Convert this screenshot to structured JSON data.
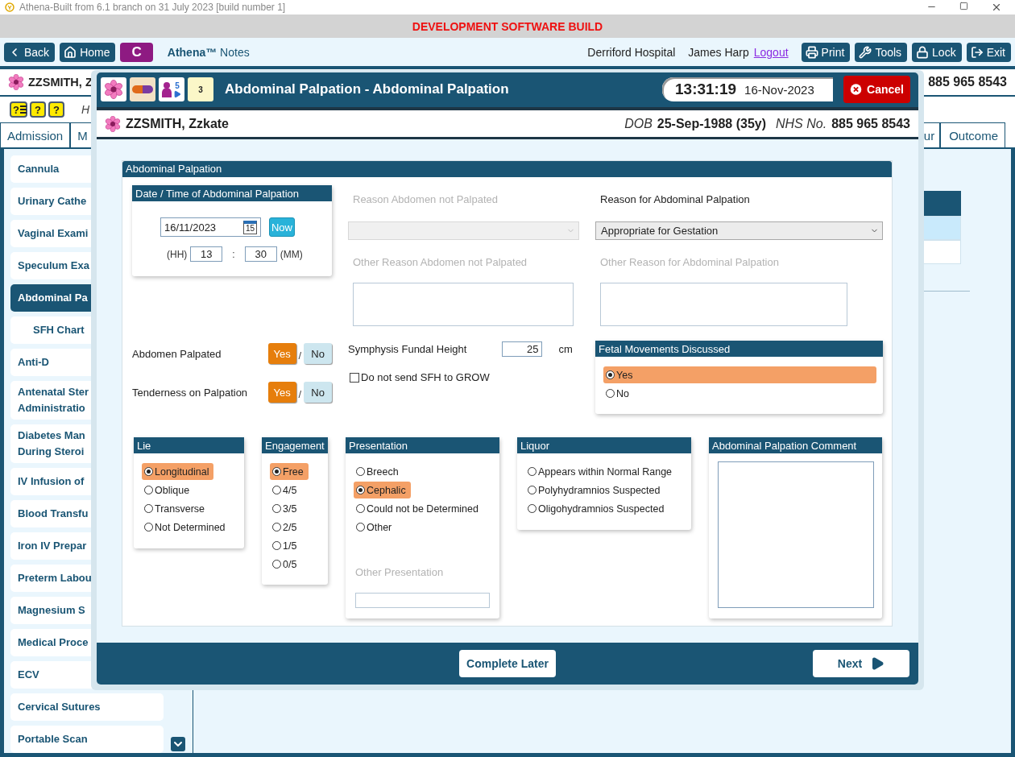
{
  "titlebar": {
    "title": "Athena-Built from 6.1 branch on 31 July 2023 [build number 1]"
  },
  "banner": "DEVELOPMENT SOFTWARE BUILD",
  "toolbar": {
    "left_buttons": [
      {
        "kind": "back",
        "label": "Back"
      },
      {
        "kind": "home",
        "label": "Home"
      },
      {
        "kind": "letter",
        "label": "C"
      }
    ],
    "app_name": "**Athena™** Notes",
    "hospital": "Derriford Hospital",
    "user": "James Harp",
    "logout": "Logout",
    "right_buttons": [
      {
        "kind": "print",
        "label": "Print"
      },
      {
        "kind": "tools",
        "label": "Tools"
      },
      {
        "kind": "lock",
        "label": "Lock"
      },
      {
        "kind": "exit",
        "label": "Exit"
      }
    ]
  },
  "patient_bar": {
    "name": "ZZSMITH, Z",
    "nhs_number": "885 965 8543"
  },
  "alert_icons": [
    {
      "kind": "list",
      "symbol": "?"
    },
    {
      "kind": "help",
      "symbol": "?"
    },
    {
      "kind": "help",
      "symbol": "?"
    }
  ],
  "alert_text": "H",
  "tabs_left": [
    {
      "label": "Admission",
      "selected": false
    },
    {
      "label": "M",
      "selected": false
    }
  ],
  "tabs_right": [
    {
      "label": "ur",
      "selected": false
    },
    {
      "label": "Outcome",
      "selected": false
    }
  ],
  "sidebar": {
    "items": [
      {
        "label": "Cannula",
        "selected": false
      },
      {
        "label": "Urinary Cathe",
        "selected": false
      },
      {
        "label": "Vaginal Exami",
        "selected": false
      },
      {
        "label": "Speculum Exa",
        "selected": false
      },
      {
        "label": "Abdominal Pa",
        "selected": true,
        "children": [
          {
            "label": "SFH Chart",
            "selected": false
          }
        ]
      },
      {
        "label": "Anti-D",
        "selected": false
      },
      {
        "label": "Antenatal Ster\nAdministratio",
        "selected": false
      },
      {
        "label": "Diabetes Man\nDuring Steroi",
        "selected": false
      },
      {
        "label": "IV Infusion of",
        "selected": false
      },
      {
        "label": "Blood Transfu",
        "selected": false
      },
      {
        "label": "Iron IV Prepar",
        "selected": false
      },
      {
        "label": "Preterm Labou",
        "selected": false
      },
      {
        "label": "Magnesium S",
        "selected": false
      },
      {
        "label": "Medical Proce",
        "selected": false
      },
      {
        "label": "ECV",
        "selected": false
      },
      {
        "label": "Cervical Sutures",
        "selected": false
      },
      {
        "label": "Portable Scan",
        "selected": false
      }
    ]
  },
  "dialog": {
    "title": "Abdominal Palpation - Abdominal Palpation",
    "task_count": "5",
    "notes_count": "3",
    "time": "13:31:19",
    "date": "16-Nov-2023",
    "cancel": "Cancel",
    "patient": {
      "name": "ZZSMITH, Zzkate",
      "dob_label": "DOB",
      "dob": "25-Sep-1988 (35y)",
      "nhs_label": "NHS No.",
      "nhs_number": "885 965 8543"
    },
    "section_title": "Abdominal Palpation",
    "datetime": {
      "title": "Date / Time of Abdominal Palpation",
      "date": "16/11/2023",
      "calendar_day": "15",
      "now": "Now",
      "hh_label": "(HH)",
      "hours": "13",
      "separator": ":",
      "minutes": "30",
      "mm_label": "(MM)"
    },
    "reason_fields": [
      {
        "kind": "select",
        "label": "Reason Abdomen not Palpated",
        "disabled": true
      },
      {
        "kind": "select",
        "label": "Reason for Abdominal Palpation",
        "value": "Appropriate for Gestation",
        "disabled": false
      },
      {
        "kind": "textarea",
        "label": "Other Reason Abdomen not Palpated",
        "disabled": true
      },
      {
        "kind": "textarea",
        "label": "Other Reason for Abdominal Palpation",
        "disabled": true
      }
    ],
    "yes_no": [
      {
        "label": "Abdomen Palpated",
        "separator": "/",
        "options": [
          {
            "label": "Yes",
            "selected": true
          },
          {
            "label": "No",
            "selected": false
          }
        ]
      },
      {
        "label": "Tenderness on Palpation",
        "separator": "/",
        "options": [
          {
            "label": "Yes",
            "selected": true
          },
          {
            "label": "No",
            "selected": false
          }
        ]
      }
    ],
    "sfh": {
      "label": "Symphysis Fundal Height",
      "value": "25",
      "unit": "cm"
    },
    "grow_checkbox": {
      "label": "Do not send SFH to GROW",
      "checked": false
    },
    "fetal_movements": {
      "title": "Fetal Movements Discussed",
      "options": [
        {
          "label": "Yes",
          "selected": true
        },
        {
          "label": "No",
          "selected": false
        }
      ]
    },
    "groups": [
      {
        "title": "Lie",
        "options": [
          {
            "label": "Longitudinal",
            "selected": true
          },
          {
            "label": "Oblique",
            "selected": false
          },
          {
            "label": "Transverse",
            "selected": false
          },
          {
            "label": "Not Determined",
            "selected": false
          }
        ]
      },
      {
        "title": "Engagement",
        "options": [
          {
            "label": "Free",
            "selected": true
          },
          {
            "label": "4/5",
            "selected": false
          },
          {
            "label": "3/5",
            "selected": false
          },
          {
            "label": "2/5",
            "selected": false
          },
          {
            "label": "1/5",
            "selected": false
          },
          {
            "label": "0/5",
            "selected": false
          }
        ]
      },
      {
        "title": "Presentation",
        "options": [
          {
            "label": "Breech",
            "selected": false
          },
          {
            "label": "Cephalic",
            "selected": true
          },
          {
            "label": "Could not be Determined",
            "selected": false
          },
          {
            "label": "Other",
            "selected": false
          }
        ],
        "other_label": "Other Presentation"
      },
      {
        "title": "Liquor",
        "options": [
          {
            "label": "Appears within Normal Range",
            "selected": false
          },
          {
            "label": "Polyhydramnios Suspected",
            "selected": false
          },
          {
            "label": "Oligohydramnios Suspected",
            "selected": false
          }
        ]
      }
    ],
    "comment": {
      "title": "Abdominal Palpation Comment"
    },
    "complete_later": "Complete Later",
    "next": "Next"
  }
}
